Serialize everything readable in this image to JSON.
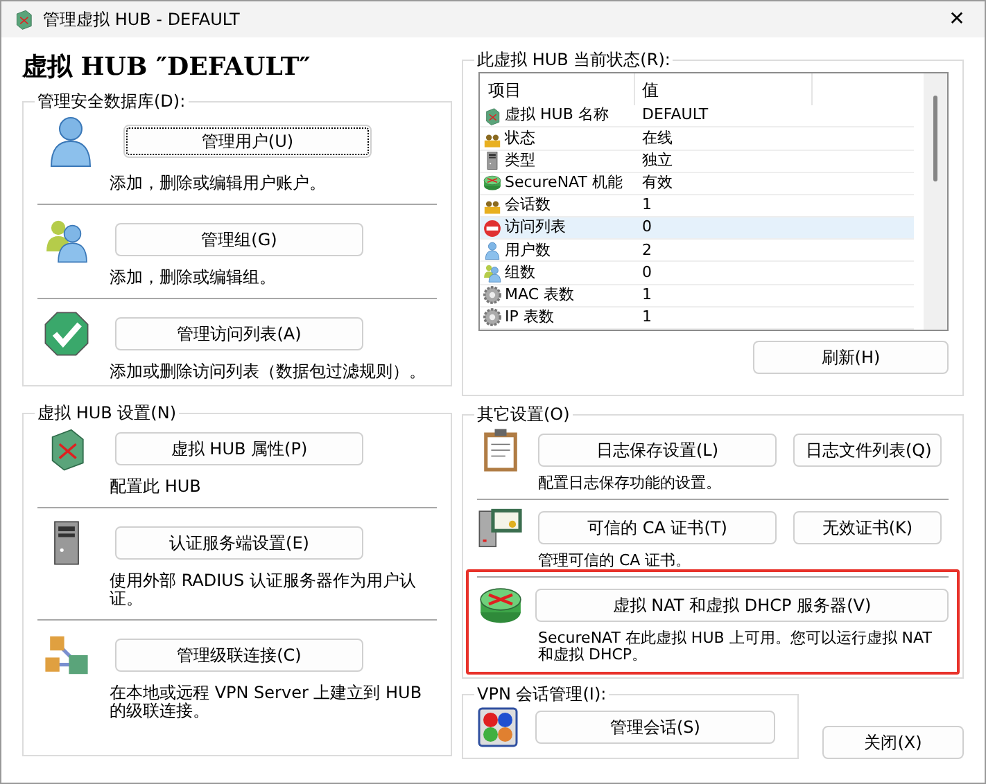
{
  "window": {
    "title": "管理虚拟 HUB - DEFAULT",
    "close": "✕"
  },
  "heading": "虚拟 HUB ″DEFAULT″",
  "security_db": {
    "label": "管理安全数据库(D):",
    "items": [
      {
        "kind": "user",
        "button": "管理用户(U)",
        "focused": true,
        "description": "添加，删除或编辑用户账户。"
      },
      {
        "kind": "group",
        "button": "管理组(G)",
        "focused": false,
        "description": "添加，删除或编辑组。"
      },
      {
        "kind": "access",
        "button": "管理访问列表(A)",
        "focused": false,
        "description": "添加或删除访问列表（数据包过滤规则）。"
      }
    ]
  },
  "hub_settings": {
    "label": "虚拟 HUB 设置(N)",
    "items": [
      {
        "kind": "hub",
        "button": "虚拟 HUB 属性(P)",
        "focused": false,
        "description": "配置此 HUB"
      },
      {
        "kind": "server",
        "button": "认证服务端设置(E)",
        "focused": false,
        "description": "使用外部 RADIUS 认证服务器作为用户认证。"
      },
      {
        "kind": "cascade",
        "button": "管理级联连接(C)",
        "focused": false,
        "description": "在本地或远程 VPN Server 上建立到 HUB 的级联连接。"
      }
    ]
  },
  "status": {
    "label": "此虚拟 HUB 当前状态(R):",
    "columns": [
      "项目",
      "值"
    ],
    "rows": [
      {
        "kind": "hub",
        "item": "虚拟 HUB 名称",
        "value": "DEFAULT",
        "selected": false
      },
      {
        "kind": "session",
        "item": "状态",
        "value": "在线",
        "selected": false
      },
      {
        "kind": "server",
        "item": "类型",
        "value": "独立",
        "selected": false
      },
      {
        "kind": "router",
        "item": "SecureNAT 机能",
        "value": "有效",
        "selected": false
      },
      {
        "kind": "session",
        "item": "会话数",
        "value": "1",
        "selected": false
      },
      {
        "kind": "deny",
        "item": "访问列表",
        "value": "0",
        "selected": true
      },
      {
        "kind": "user",
        "item": "用户数",
        "value": "2",
        "selected": false
      },
      {
        "kind": "group",
        "item": "组数",
        "value": "0",
        "selected": false
      },
      {
        "kind": "gear",
        "item": "MAC 表数",
        "value": "1",
        "selected": false
      },
      {
        "kind": "gear",
        "item": "IP 表数",
        "value": "1",
        "selected": false
      }
    ],
    "refresh_button": "刷新(H)"
  },
  "other_settings": {
    "label": "其它设置(O)",
    "items": [
      {
        "kind": "log",
        "buttons": [
          "日志保存设置(L)",
          "日志文件列表(Q)"
        ],
        "description": "配置日志保存功能的设置。",
        "highlighted": false
      },
      {
        "kind": "cert",
        "buttons": [
          "可信的 CA 证书(T)",
          "无效证书(K)"
        ],
        "description": "管理可信的 CA 证书。",
        "highlighted": false
      },
      {
        "kind": "router",
        "buttons": [
          "虚拟 NAT 和虚拟 DHCP 服务器(V)"
        ],
        "description": "SecureNAT 在此虚拟 HUB 上可用。您可以运行虚拟 NAT 和虚拟 DHCP。",
        "highlighted": true
      }
    ]
  },
  "vpn_sessions": {
    "label": "VPN 会话管理(I):",
    "button": "管理会话(S)"
  },
  "close_button": "关闭(X)"
}
